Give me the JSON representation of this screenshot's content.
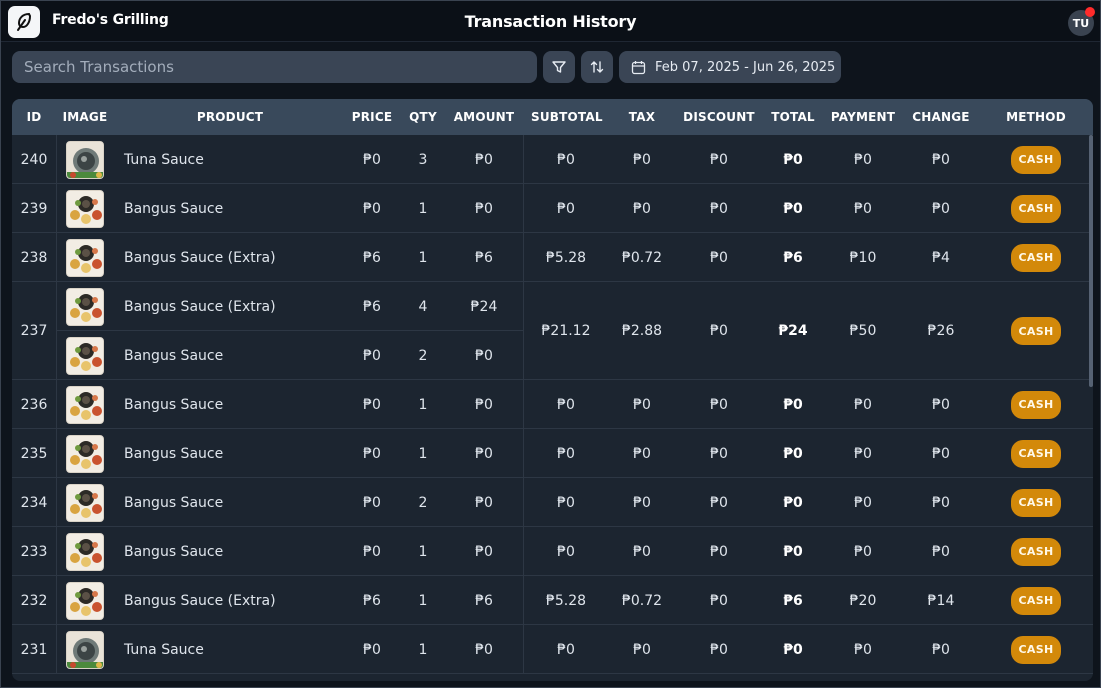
{
  "app": {
    "name": "Fredo's Grilling",
    "title": "Transaction History",
    "user_initials": "TU"
  },
  "toolbar": {
    "search_placeholder": "Search Transactions",
    "date_range": "Feb 07, 2025 - Jun 26, 2025",
    "filter_icon": "filter-icon",
    "sort_icon": "sort-icon",
    "calendar_icon": "calendar-icon"
  },
  "colors": {
    "accent": "#d3890a",
    "header": "#39495b",
    "card": "#1c2530"
  },
  "table": {
    "columns": [
      "ID",
      "IMAGE",
      "PRODUCT",
      "PRICE",
      "QTY",
      "AMOUNT",
      "SUBTOTAL",
      "TAX",
      "DISCOUNT",
      "TOTAL",
      "PAYMENT",
      "CHANGE",
      "METHOD"
    ],
    "rows": [
      {
        "id": "240",
        "items": [
          {
            "image": "tuna",
            "product": "Tuna Sauce",
            "price": "₱0",
            "qty": "3",
            "amount": "₱0"
          }
        ],
        "subtotal": "₱0",
        "tax": "₱0",
        "discount": "₱0",
        "total": "₱0",
        "payment": "₱0",
        "change": "₱0",
        "method": "CASH"
      },
      {
        "id": "239",
        "items": [
          {
            "image": "bangus",
            "product": "Bangus Sauce",
            "price": "₱0",
            "qty": "1",
            "amount": "₱0"
          }
        ],
        "subtotal": "₱0",
        "tax": "₱0",
        "discount": "₱0",
        "total": "₱0",
        "payment": "₱0",
        "change": "₱0",
        "method": "CASH"
      },
      {
        "id": "238",
        "items": [
          {
            "image": "bangus",
            "product": "Bangus Sauce (Extra)",
            "price": "₱6",
            "qty": "1",
            "amount": "₱6"
          }
        ],
        "subtotal": "₱5.28",
        "tax": "₱0.72",
        "discount": "₱0",
        "total": "₱6",
        "payment": "₱10",
        "change": "₱4",
        "method": "CASH"
      },
      {
        "id": "237",
        "items": [
          {
            "image": "bangus",
            "product": "Bangus Sauce (Extra)",
            "price": "₱6",
            "qty": "4",
            "amount": "₱24"
          },
          {
            "image": "bangus",
            "product": "Bangus Sauce",
            "price": "₱0",
            "qty": "2",
            "amount": "₱0"
          }
        ],
        "subtotal": "₱21.12",
        "tax": "₱2.88",
        "discount": "₱0",
        "total": "₱24",
        "payment": "₱50",
        "change": "₱26",
        "method": "CASH"
      },
      {
        "id": "236",
        "items": [
          {
            "image": "bangus",
            "product": "Bangus Sauce",
            "price": "₱0",
            "qty": "1",
            "amount": "₱0"
          }
        ],
        "subtotal": "₱0",
        "tax": "₱0",
        "discount": "₱0",
        "total": "₱0",
        "payment": "₱0",
        "change": "₱0",
        "method": "CASH"
      },
      {
        "id": "235",
        "items": [
          {
            "image": "bangus",
            "product": "Bangus Sauce",
            "price": "₱0",
            "qty": "1",
            "amount": "₱0"
          }
        ],
        "subtotal": "₱0",
        "tax": "₱0",
        "discount": "₱0",
        "total": "₱0",
        "payment": "₱0",
        "change": "₱0",
        "method": "CASH"
      },
      {
        "id": "234",
        "items": [
          {
            "image": "bangus",
            "product": "Bangus Sauce",
            "price": "₱0",
            "qty": "2",
            "amount": "₱0"
          }
        ],
        "subtotal": "₱0",
        "tax": "₱0",
        "discount": "₱0",
        "total": "₱0",
        "payment": "₱0",
        "change": "₱0",
        "method": "CASH"
      },
      {
        "id": "233",
        "items": [
          {
            "image": "bangus",
            "product": "Bangus Sauce",
            "price": "₱0",
            "qty": "1",
            "amount": "₱0"
          }
        ],
        "subtotal": "₱0",
        "tax": "₱0",
        "discount": "₱0",
        "total": "₱0",
        "payment": "₱0",
        "change": "₱0",
        "method": "CASH"
      },
      {
        "id": "232",
        "items": [
          {
            "image": "bangus",
            "product": "Bangus Sauce (Extra)",
            "price": "₱6",
            "qty": "1",
            "amount": "₱6"
          }
        ],
        "subtotal": "₱5.28",
        "tax": "₱0.72",
        "discount": "₱0",
        "total": "₱6",
        "payment": "₱20",
        "change": "₱14",
        "method": "CASH"
      },
      {
        "id": "231",
        "items": [
          {
            "image": "tuna",
            "product": "Tuna Sauce",
            "price": "₱0",
            "qty": "1",
            "amount": "₱0"
          }
        ],
        "subtotal": "₱0",
        "tax": "₱0",
        "discount": "₱0",
        "total": "₱0",
        "payment": "₱0",
        "change": "₱0",
        "method": "CASH"
      }
    ]
  }
}
